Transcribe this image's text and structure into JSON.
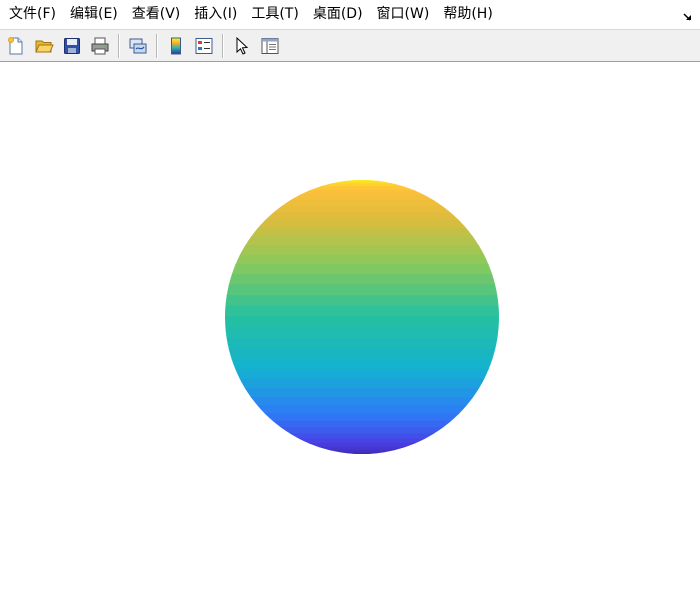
{
  "menubar": {
    "items": [
      {
        "label": "文件(F)"
      },
      {
        "label": "编辑(E)"
      },
      {
        "label": "查看(V)"
      },
      {
        "label": "插入(I)"
      },
      {
        "label": "工具(T)"
      },
      {
        "label": "桌面(D)"
      },
      {
        "label": "窗口(W)"
      },
      {
        "label": "帮助(H)"
      }
    ],
    "dock_icon": "dock-arrow-icon"
  },
  "toolbar": {
    "buttons": [
      {
        "icon": "new-figure-icon"
      },
      {
        "icon": "open-file-icon"
      },
      {
        "icon": "save-icon"
      },
      {
        "icon": "print-icon"
      },
      {
        "icon": "link-plot-icon"
      },
      {
        "icon": "insert-colorbar-icon"
      },
      {
        "icon": "insert-legend-icon"
      },
      {
        "icon": "edit-plot-icon"
      },
      {
        "icon": "property-inspector-icon"
      }
    ]
  },
  "figure": {
    "content": "sphere surface",
    "colormap": [
      "#3e26a8",
      "#4a3de3",
      "#2e7bf7",
      "#14b1d1",
      "#25c0a0",
      "#8ac95a",
      "#ddbc3c",
      "#fec03a",
      "#f9fb14"
    ]
  }
}
